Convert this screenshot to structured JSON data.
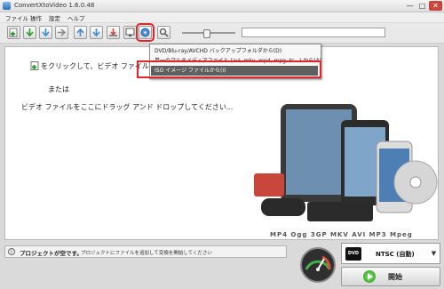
{
  "window": {
    "title": "ConvertXtoVideo 1.6.0.48",
    "minimize": "—",
    "maximize": "□",
    "close": "✕"
  },
  "menu": [
    "ファイル",
    "操作",
    "設定",
    "ヘルプ"
  ],
  "toolbar": {
    "buttons": [
      "add-file",
      "add-folder",
      "move-down",
      "move-right",
      "move-up",
      "move-down-arrow",
      "open-output",
      "preview",
      "import-disc",
      "search"
    ],
    "highlighted": "import-disc"
  },
  "dropdown": {
    "items": [
      "DVD/Blu-ray/AVCHD バックアップフォルダから(D)",
      "単一のマルチメディアファイル (avi, mkv, mp4, mpg, ts...) から(A)",
      "ISO イメージ ファイルから(I)"
    ],
    "selected_index": 2
  },
  "main": {
    "hint_line1": "をクリックして、ビデオ ファイル",
    "hint_line2": "または",
    "hint_line3": "ビデオ ファイルをここにドラッグ アンド ドロップしてください...",
    "format_labels": [
      "MP4",
      "Ogg",
      "3GP",
      "MKV",
      "AVI",
      "MP3",
      "Mpeg"
    ]
  },
  "status": {
    "title": "プロジェクトが空です。",
    "text": "プロジェクトにファイルを追加して変換を開始してください"
  },
  "output": {
    "format": "NTSC (自動)",
    "dvd_logo": "DVD"
  },
  "start_button": {
    "label": "開始"
  },
  "colors": {
    "highlight": "#e0262a",
    "accent": "#2f9a1d"
  }
}
